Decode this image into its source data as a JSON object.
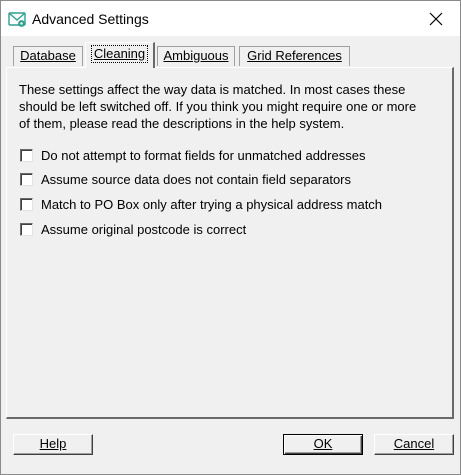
{
  "window": {
    "title": "Advanced Settings"
  },
  "tabs": [
    {
      "label": "Database",
      "active": false
    },
    {
      "label": "Cleaning",
      "active": true
    },
    {
      "label": "Ambiguous",
      "active": false
    },
    {
      "label": "Grid References",
      "active": false
    }
  ],
  "intro": {
    "lines": [
      "These settings affect the way data is matched.  In most cases these",
      "should be left switched off.  If you think you might require one or more",
      "of them, please read the descriptions in the help system."
    ]
  },
  "options": [
    {
      "label": "Do not attempt to format fields for unmatched addresses",
      "checked": false
    },
    {
      "label": "Assume source data does not contain field separators",
      "checked": false
    },
    {
      "label": "Match to PO Box only after trying a physical address match",
      "checked": false
    },
    {
      "label": "Assume original postcode is correct",
      "checked": false
    }
  ],
  "buttons": {
    "help": "Help",
    "ok": "OK",
    "cancel": "Cancel"
  },
  "icons": {
    "app": "envelope-gear-icon",
    "close": "close-icon"
  },
  "colors": {
    "app_icon": "#2e9e8e"
  }
}
